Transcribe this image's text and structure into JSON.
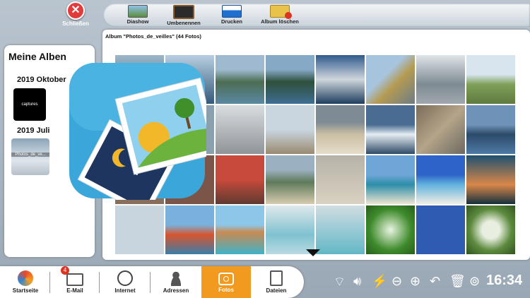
{
  "close_label": "Schließen",
  "toolbar": {
    "slideshow": "Diashow",
    "rename": "Umbenennen",
    "print": "Drucken",
    "delete_album": "Album löschen"
  },
  "sidebar": {
    "title": "Meine Alben",
    "groups": [
      {
        "year": "2019 Oktober",
        "album": "captures"
      },
      {
        "year": "2019 Juli",
        "album": "Photos_de_ve..."
      }
    ]
  },
  "main": {
    "album_title": "Album \"Photos_de_veilles\" (44 Fotos)"
  },
  "bottom_nav": {
    "home": "Startseite",
    "email": "E-Mail",
    "email_badge": "4",
    "internet": "Internet",
    "contacts": "Adressen",
    "photos": "Fotos",
    "files": "Dateien"
  },
  "tray": {
    "time": "16:34"
  },
  "colors": {
    "active_tab": "#f29a1f",
    "close": "#e23b3b",
    "logo_bg": "#3aa6d9"
  }
}
